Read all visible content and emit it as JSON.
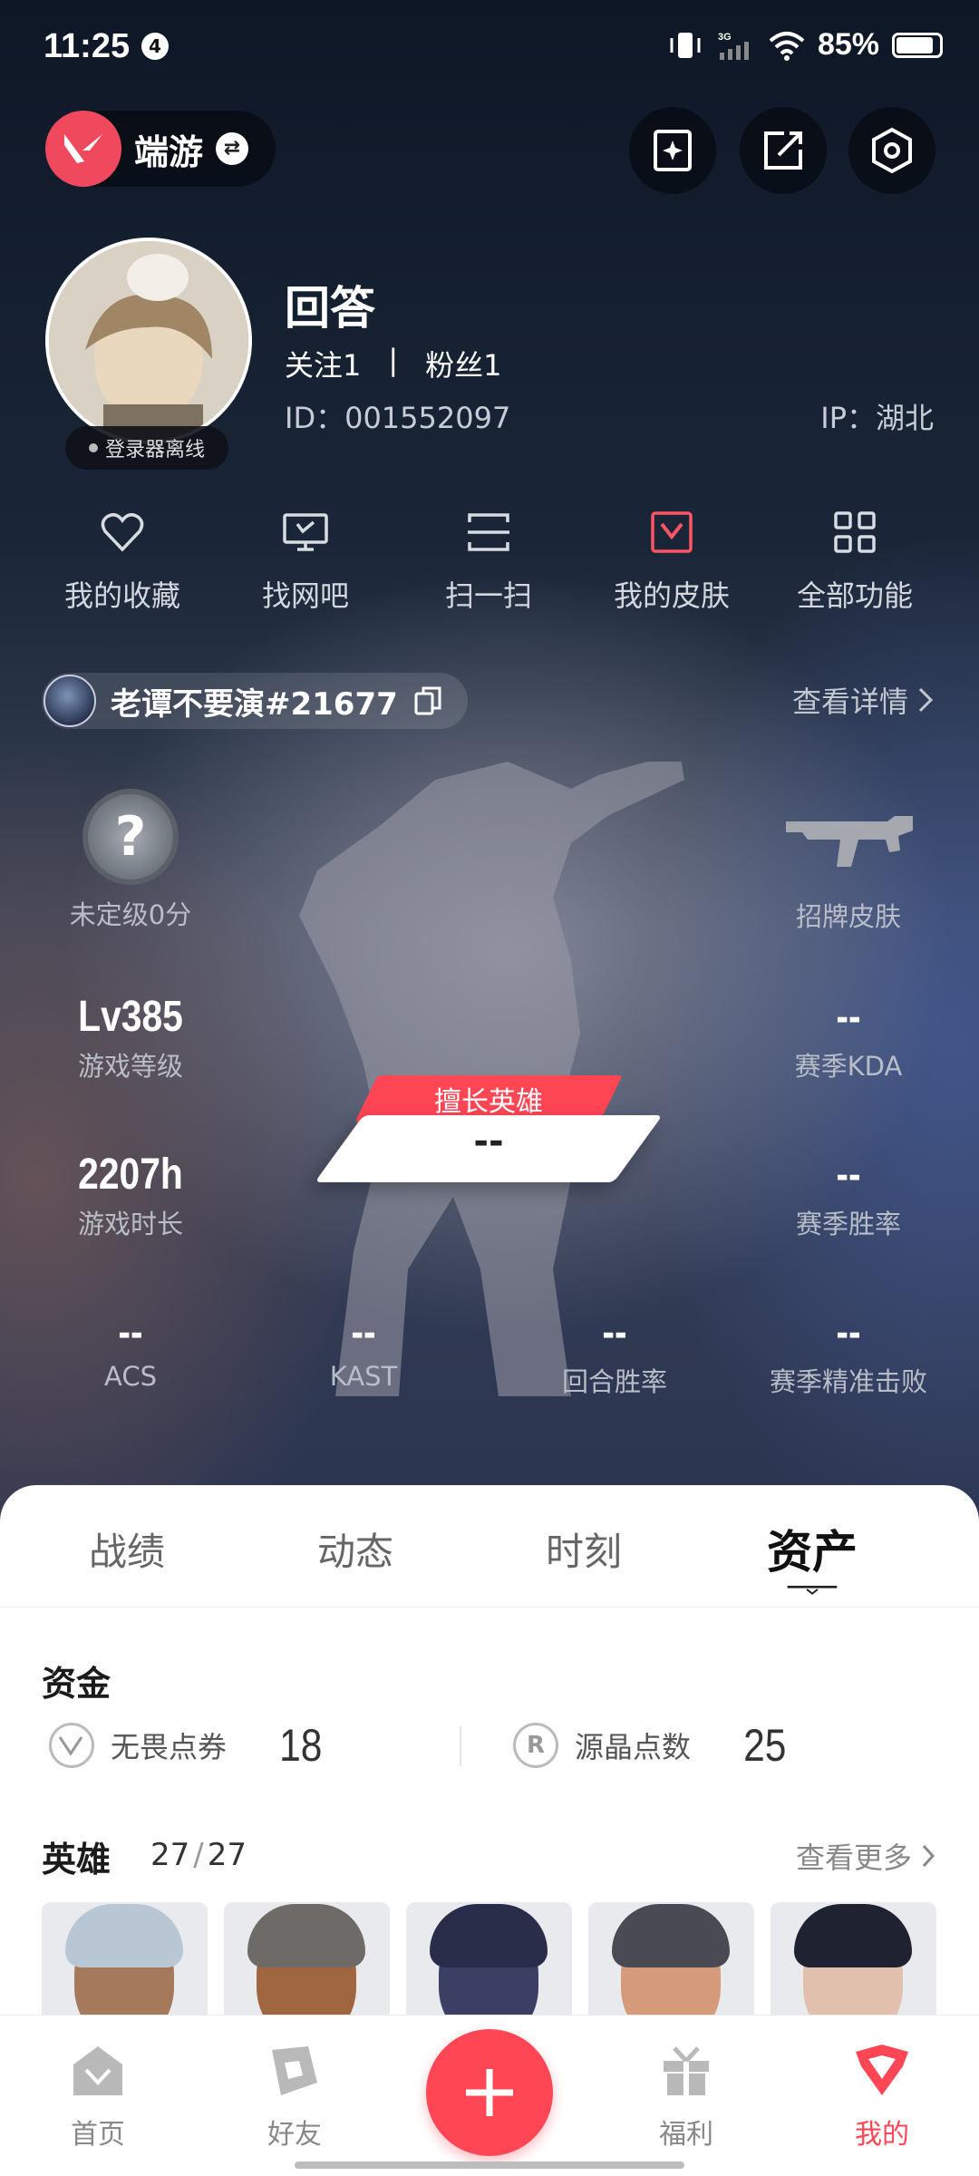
{
  "status_bar": {
    "time": "11:25",
    "notification_count": "4",
    "network": "3G",
    "battery": "85%"
  },
  "header": {
    "game_name": "端游"
  },
  "profile": {
    "name": "回答",
    "follow": "关注1",
    "separator": "|",
    "fans": "粉丝1",
    "id": "ID：001552097",
    "ip": "IP：湖北",
    "login_status": "登录器离线"
  },
  "quick_menu": [
    {
      "label": "我的收藏",
      "icon": "heart-icon"
    },
    {
      "label": "找网吧",
      "icon": "monitor-icon"
    },
    {
      "label": "扫一扫",
      "icon": "scan-icon"
    },
    {
      "label": "我的皮肤",
      "icon": "skin-icon"
    },
    {
      "label": "全部功能",
      "icon": "grid-icon"
    }
  ],
  "player": {
    "tag": "老谭不要演#21677",
    "view_detail": "查看详情"
  },
  "stats": {
    "rank": {
      "label": "未定级0分",
      "badge": "?"
    },
    "signature_skin": {
      "label": "招牌皮肤"
    },
    "level": {
      "value": "Lv385",
      "label": "游戏等级"
    },
    "kda": {
      "value": "--",
      "label": "赛季KDA"
    },
    "hours": {
      "value": "2207h",
      "label": "游戏时长"
    },
    "winrate": {
      "value": "--",
      "label": "赛季胜率"
    },
    "acs": {
      "value": "--",
      "label": "ACS"
    },
    "kast": {
      "value": "--",
      "label": "KAST"
    },
    "round_winrate": {
      "value": "--",
      "label": "回合胜率"
    },
    "precise_kills": {
      "value": "--",
      "label": "赛季精准击败"
    },
    "best_hero": {
      "tag": "擅长英雄",
      "value": "--"
    }
  },
  "tabs": [
    "战绩",
    "动态",
    "时刻",
    "资产"
  ],
  "active_tab": "资产",
  "funds": {
    "title": "资金",
    "items": [
      {
        "label": "无畏点券",
        "value": "18",
        "icon": "vp-icon"
      },
      {
        "label": "源晶点数",
        "value": "25",
        "icon": "radianite-icon",
        "glyph": "R"
      }
    ]
  },
  "heroes": {
    "title": "英雄",
    "owned": "27",
    "slash": "/",
    "total": "27",
    "more": "查看更多"
  },
  "bottom_nav": [
    {
      "label": "首页",
      "icon": "home-icon"
    },
    {
      "label": "好友",
      "icon": "friends-icon"
    },
    {
      "label": "福利",
      "icon": "gift-icon"
    },
    {
      "label": "我的",
      "icon": "profile-icon",
      "active": true
    }
  ],
  "colors": {
    "accent": "#ff4655",
    "dark_bg": "#151c2c"
  }
}
